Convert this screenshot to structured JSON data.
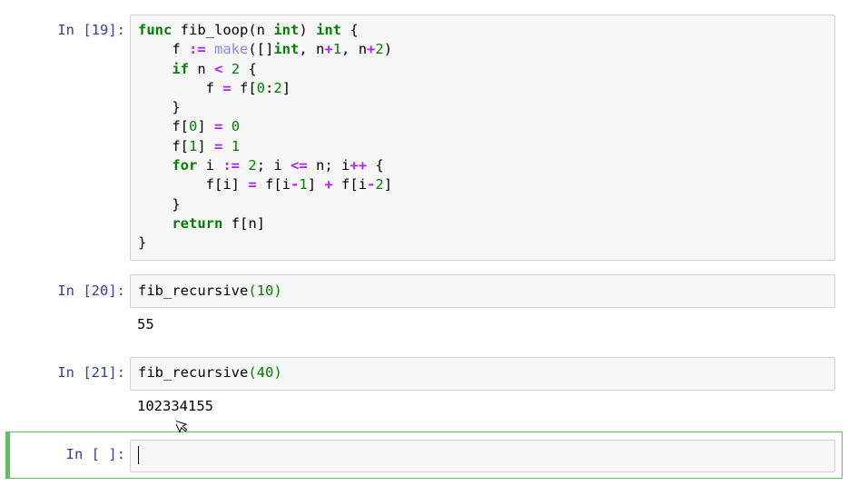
{
  "cells": [
    {
      "prompt": "In [19]:",
      "code_lines": [
        "func fib_loop(n int) int {",
        "    f := make([]int, n+1, n+2)",
        "    if n < 2 {",
        "        f = f[0:2]",
        "    }",
        "    f[0] = 0",
        "    f[1] = 1",
        "    for i := 2; i <= n; i++ {",
        "        f[i] = f[i-1] + f[i-2]",
        "    }",
        "    return f[n]",
        "}"
      ]
    },
    {
      "prompt": "In [20]:",
      "code": "fib_recursive(10)",
      "output": "55"
    },
    {
      "prompt": "In [21]:",
      "code": "fib_recursive(40)",
      "output": "102334155"
    },
    {
      "prompt": "In [ ]:",
      "code": ""
    }
  ],
  "colors": {
    "prompt": "#303f9f",
    "keyword": "#008000",
    "operator": "#aa22ff",
    "builtin": "#8888ff",
    "active_border": "#66bb6a"
  }
}
